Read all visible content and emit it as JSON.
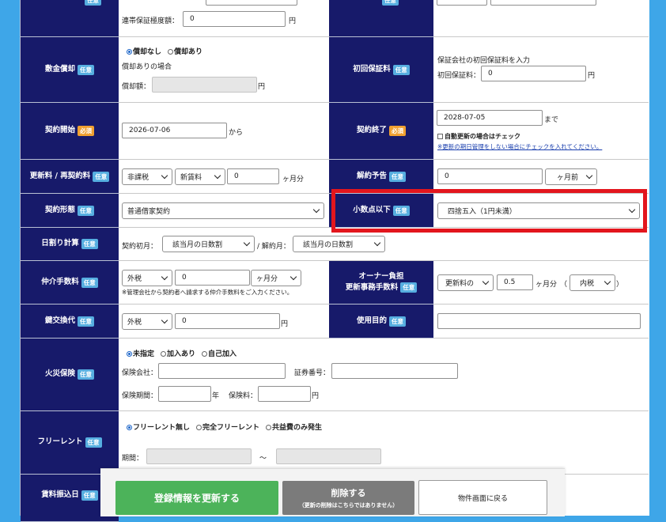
{
  "rows": {
    "joint_guarantee": {
      "label": "連帯保証極度額：",
      "value": "0",
      "unit": "円"
    },
    "shikikin_shokyaku": {
      "label": "敷金償却",
      "badge": "任意",
      "radio_none": "償却なし",
      "radio_yes": "償却あり",
      "note": "償却ありの場合",
      "amount_label": "償却額：",
      "amount_value": "",
      "unit": "円"
    },
    "initial_guarantee_fee": {
      "label": "初回保証料",
      "badge": "任意",
      "note": "保証会社の初回保証料を入力",
      "field_label": "初回保証料：",
      "value": "0",
      "unit": "円"
    },
    "contract_start": {
      "label": "契約開始",
      "badge": "必須",
      "value": "2026-07-06",
      "suffix": "から"
    },
    "contract_end": {
      "label": "契約終了",
      "badge": "必須",
      "value": "2028-07-05",
      "suffix": "まで",
      "auto_renew_label": "自動更新の場合はチェック",
      "auto_renew_note": "※更新の期日管理をしない場合にチェックを入れてください。"
    },
    "renewal_fee": {
      "label": "更新料 / 再契約料",
      "badge": "任意",
      "tax": "非課税",
      "base": "新賃料",
      "value": "0",
      "unit": "ヶ月分"
    },
    "cancellation_notice": {
      "label": "解約予告",
      "badge": "任意",
      "value": "0",
      "unit": "ヶ月前"
    },
    "contract_type": {
      "label": "契約形態",
      "badge": "任意",
      "value": "普通借家契約"
    },
    "rounding": {
      "label": "小数点以下",
      "badge": "任意",
      "value": "四捨五入（1円未満）"
    },
    "daily_proration": {
      "label": "日割り計算",
      "badge": "任意",
      "first_month_label": "契約初月：",
      "first_month_value": "該当月の日数割",
      "sep": "/ 解約月：",
      "cancel_month_value": "該当月の日数割"
    },
    "brokerage_fee": {
      "label": "仲介手数料",
      "badge": "任意",
      "tax": "外税",
      "value": "0",
      "unit": "ヶ月分",
      "note": "※管理会社から契約者へ請求する仲介手数料をご入力ください。"
    },
    "owner_renewal_fee": {
      "label_line1": "オーナー負担",
      "label_line2": "更新事務手数料",
      "badge": "任意",
      "base": "更新料の",
      "value": "0.5",
      "unit": "ヶ月分",
      "paren_open": "（",
      "tax": "内税",
      "paren_close": "）"
    },
    "key_exchange": {
      "label": "鍵交換代",
      "badge": "任意",
      "tax": "外税",
      "value": "0",
      "unit": "円"
    },
    "purpose": {
      "label": "使用目的",
      "badge": "任意",
      "value": ""
    },
    "fire_insurance": {
      "label": "火災保険",
      "badge": "任意",
      "radio_unspecified": "未指定",
      "radio_joined": "加入あり",
      "radio_self": "自己加入",
      "company_label": "保険会社：",
      "company_value": "",
      "cert_label": "証券番号：",
      "cert_value": "",
      "period_label": "保険期間：",
      "period_value": "",
      "period_unit": "年",
      "premium_label": "保険料：",
      "premium_value": "",
      "premium_unit": "円"
    },
    "free_rent": {
      "label": "フリーレント",
      "badge": "任意",
      "radio_none": "フリーレント無し",
      "radio_full": "完全フリーレント",
      "radio_common": "共益費のみ発生",
      "period_label": "期間：",
      "tilde": "〜"
    },
    "rent_transfer_date": {
      "label": "賃料振込日",
      "badge": "任意"
    }
  },
  "footer": {
    "update_button": "登録情報を更新する",
    "delete_button": "削除する",
    "delete_note": "（更新の削除はこちらではありません）",
    "back_button": "物件画面に戻る"
  },
  "colors": {
    "page_background": "#3ea6e8",
    "label_background": "#171a6a",
    "optional_badge": "#56aee0",
    "required_badge": "#f0a030",
    "highlight_box": "#e3161d",
    "update_button": "#4cb35a",
    "delete_button": "#7b7b7b"
  }
}
